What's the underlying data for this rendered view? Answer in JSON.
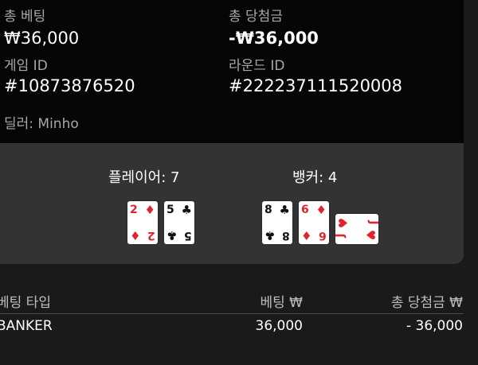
{
  "summary": {
    "total_bet_label": "총 베팅",
    "total_bet_value": "₩36,000",
    "total_win_label": "총 당첨금",
    "total_win_value": "-₩36,000",
    "game_id_label": "게임 ID",
    "game_id_value": "#10873876520",
    "round_id_label": "라운드 ID",
    "round_id_value": "#222237111520008",
    "dealer": "딜러: Minho"
  },
  "hands": {
    "player_title": "플레이어: 7",
    "banker_title": "뱅커: 4",
    "player_cards": [
      {
        "rank": "2",
        "suit": "♦",
        "color": "#e0242e"
      },
      {
        "rank": "5",
        "suit": "♣",
        "color": "#111111"
      }
    ],
    "banker_cards": [
      {
        "rank": "8",
        "suit": "♣",
        "color": "#111111"
      },
      {
        "rank": "6",
        "suit": "♦",
        "color": "#e0242e"
      },
      {
        "rank": "J",
        "suit": "♥",
        "color": "#e0242e",
        "orientation": "sideways"
      }
    ]
  },
  "table": {
    "headers": [
      "베팅 타입",
      "베팅 ₩",
      "총 당첨금 ₩"
    ],
    "rows": [
      [
        "BANKER",
        "36,000",
        "- 36,000"
      ]
    ]
  }
}
